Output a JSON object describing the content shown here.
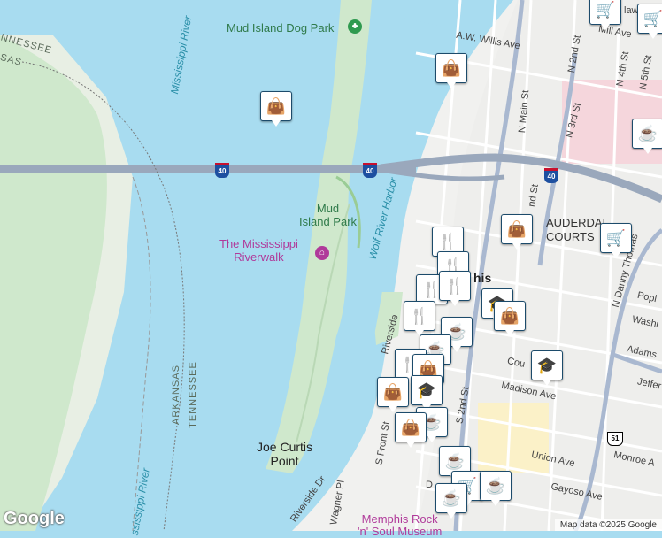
{
  "labels": {
    "dog_park": "Mud Island Dog Park",
    "mississippi_river_1": "Mississippi River",
    "mississippi_river_2": "ssissippi River",
    "mud_island_park": "Mud\nIsland Park",
    "riverwalk": "The Mississippi\nRiverwalk",
    "wolf_river_harbor": "Wolf River Harbor",
    "arkansas": "ARKANSAS",
    "tennessee": "TENNESSEE",
    "tennessee_corner": "NNESSEE",
    "tennessee_corner2": "SAS",
    "joe_curtis_point": "Joe Curtis\nPoint",
    "memphis": "his",
    "lauderdale_courts": "AUDERDAL\nCOURTS",
    "rock_n_soul": "Memphis Rock\n'n' Soul Museum",
    "aw_willis": "A.W. Willis Ave",
    "mill_ave": "Mill Ave",
    "n_2nd": "N 2nd St",
    "n_3rd": "N 3rd St",
    "n_4th": "N 4th St",
    "n_5th": "N 5th St",
    "n_main": "N Main St",
    "riverside_dr": "Riverside Dr",
    "riverside": "Riverside",
    "s_front": "S Front St",
    "s_2nd": "S 2nd St",
    "wagner": "Wagner Pl",
    "madison": "Madison Ave",
    "union": "Union Ave",
    "gayoso": "Gayoso Ave",
    "monroe": "Monroe A",
    "adams": "Adams",
    "jefferson": "Jeffer",
    "poplar": "Popl",
    "washington": "Washi",
    "court": "Cou",
    "n_danny_thomas": "N Danny Thomas",
    "law": "law",
    "d_lbl": "D",
    "nd_st": "nd St",
    "r_lbl": "r"
  },
  "shields": {
    "i40": "40",
    "us51": "51"
  },
  "footer": {
    "google": "Google",
    "attribution": "Map data ©2025 Google"
  },
  "icons": {
    "shopping": "shopping-bag",
    "restaurant": "restaurant",
    "cafe": "cafe",
    "grocery": "grocery-cart",
    "school": "school",
    "park": "park",
    "museum": "museum"
  }
}
